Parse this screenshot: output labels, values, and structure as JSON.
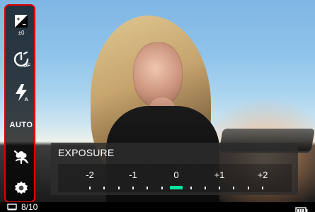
{
  "toolbar": {
    "auto_label": "AUTO",
    "exposure_comp_label": "±0"
  },
  "exposure_panel": {
    "title": "EXPOSURE",
    "scale_labels": [
      "-2",
      "-1",
      "0",
      "+1",
      "+2"
    ],
    "selected_value": "0"
  },
  "status": {
    "frame_counter": "8/10"
  },
  "colors": {
    "toolbar_outline": "#e10000",
    "selection_indicator": "#00e6a1"
  },
  "icons": {
    "exposure": "exposure-comp-icon",
    "timer": "timer-off-icon",
    "flash": "flash-auto-icon",
    "macro": "macro-flower-icon",
    "settings": "gear-icon",
    "frame": "frame-icon",
    "battery": "battery-icon"
  }
}
